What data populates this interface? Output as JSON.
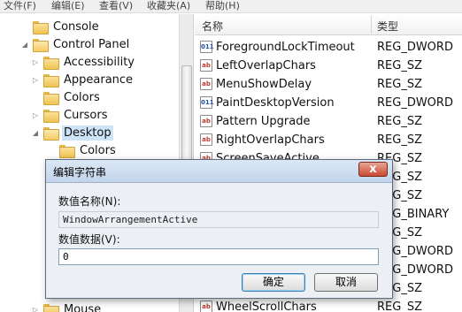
{
  "menubar": {
    "items": [
      "文件(F)",
      "编辑(E)",
      "查看(V)",
      "收藏夹(A)",
      "帮助(H)"
    ]
  },
  "tree": {
    "items": [
      {
        "label": "Console",
        "state": "none",
        "level": 0
      },
      {
        "label": "Control Panel",
        "state": "expanded",
        "level": 0
      },
      {
        "label": "Accessibility",
        "state": "collapsed",
        "level": 1
      },
      {
        "label": "Appearance",
        "state": "collapsed",
        "level": 1
      },
      {
        "label": "Colors",
        "state": "none",
        "level": 1
      },
      {
        "label": "Cursors",
        "state": "collapsed",
        "level": 1
      },
      {
        "label": "Desktop",
        "state": "expanded",
        "level": 1,
        "selected": true
      },
      {
        "label": "Colors",
        "state": "none",
        "level": 2
      },
      {
        "label": "Mouse",
        "state": "collapsed",
        "level": 1
      }
    ]
  },
  "list": {
    "header_name": "名称",
    "header_type": "类型",
    "rows": [
      {
        "name": "ForegroundLockTimeout",
        "type": "REG_DWORD",
        "icon": "bin"
      },
      {
        "name": "LeftOverlapChars",
        "type": "REG_SZ",
        "icon": "sz"
      },
      {
        "name": "MenuShowDelay",
        "type": "REG_SZ",
        "icon": "sz"
      },
      {
        "name": "PaintDesktopVersion",
        "type": "REG_DWORD",
        "icon": "bin"
      },
      {
        "name": "Pattern Upgrade",
        "type": "REG_SZ",
        "icon": "sz"
      },
      {
        "name": "RightOverlapChars",
        "type": "REG_SZ",
        "icon": "sz"
      },
      {
        "name": "ScreenSaveActive",
        "type": "REG_SZ",
        "icon": "sz"
      },
      {
        "name": "",
        "type": "REG_SZ",
        "icon": "sz"
      },
      {
        "name": "",
        "type": "REG_SZ",
        "icon": "sz"
      },
      {
        "name": "",
        "type": "REG_BINARY",
        "icon": "bin"
      },
      {
        "name": "",
        "type": "REG_SZ",
        "icon": "sz"
      },
      {
        "name": "",
        "type": "REG_DWORD",
        "icon": "bin"
      },
      {
        "name": "",
        "type": "REG_DWORD",
        "icon": "bin"
      },
      {
        "name": "",
        "type": "REG_SZ",
        "icon": "sz"
      },
      {
        "name": "WheelScrollChars",
        "type": "REG_SZ",
        "icon": "sz"
      }
    ]
  },
  "dialog": {
    "title": "编辑字符串",
    "close_glyph": "x",
    "name_label": "数值名称(N):",
    "name_value": "WindowArrangementActive",
    "data_label": "数值数据(V):",
    "data_value": "0",
    "ok_label": "确定",
    "cancel_label": "取消"
  },
  "icons": {
    "sz": "ab",
    "bin": "011"
  }
}
